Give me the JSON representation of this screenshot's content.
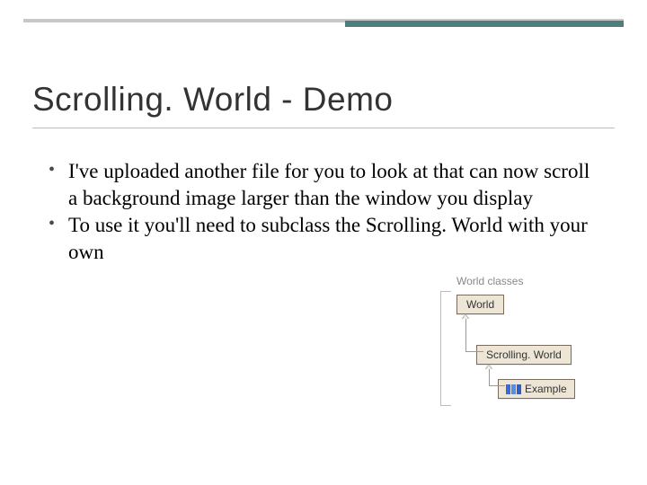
{
  "title": {
    "full": "Scrolling. World - Demo"
  },
  "bullets": [
    "I've uploaded another file for you to look at that can now scroll a background image larger than the window you display",
    "To use it you'll need to subclass the Scrolling. World with your own"
  ],
  "diagram": {
    "group_label": "World classes",
    "boxes": {
      "world": "World",
      "scrolling": "Scrolling. World",
      "example": "Example"
    }
  }
}
